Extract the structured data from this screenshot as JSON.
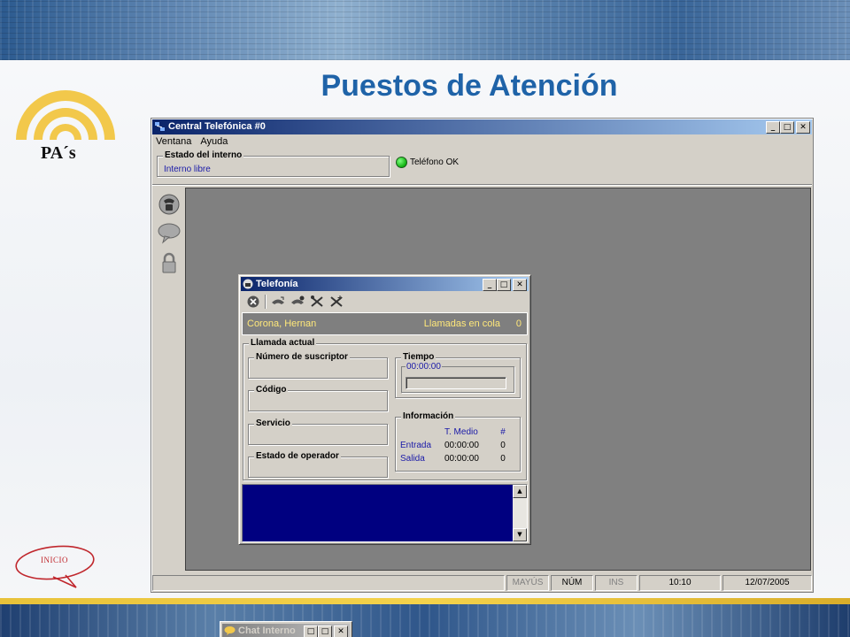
{
  "slide": {
    "title": "Puestos de Atención",
    "logo_text": "PA´s",
    "inicio_label": "INICIO"
  },
  "main_window": {
    "title": "Central Telefónica #0",
    "controls": {
      "minimize": "_",
      "maximize": "□",
      "close": "✕"
    },
    "menu": [
      "Ventana",
      "Ayuda"
    ],
    "estado_label": "Estado del interno",
    "estado_value": "Interno libre",
    "telefono_status": "Teléfono OK",
    "left_toolbar_icons": [
      "phone-icon",
      "chat-bubble-icon",
      "lock-icon"
    ]
  },
  "telefonia": {
    "title": "Telefonía",
    "toolbar_icons": [
      "cancel-circle-icon",
      "answer-call-icon",
      "transfer-call-icon",
      "tools-icon",
      "tools-add-icon"
    ],
    "operator_name": "Corona, Hernan",
    "queue_label": "Llamadas en cola",
    "queue_count": "0",
    "llamada_actual": {
      "label": "Llamada actual",
      "fields": [
        "Número de suscriptor",
        "Código",
        "Servicio",
        "Estado de operador"
      ]
    },
    "tiempo": {
      "label": "Tiempo",
      "value": "00:00:00"
    },
    "informacion": {
      "label": "Información",
      "headers": [
        "T. Medio",
        "#"
      ],
      "rows": [
        {
          "label": "Entrada",
          "t_medio": "00:00:00",
          "count": "0"
        },
        {
          "label": "Salida",
          "t_medio": "00:00:00",
          "count": "0"
        }
      ]
    }
  },
  "chat_window": {
    "title": "Chat Interno"
  },
  "status_bar": {
    "mayus": "MAYÚS",
    "num": "NÚM",
    "ins": "INS",
    "time": "10:10",
    "date": "12/07/2005"
  },
  "colors": {
    "title_blue": "#1f63a8",
    "titlebar_dark": "#0a246a",
    "dialog_face": "#d4d0c8",
    "mdi_gray": "#808080",
    "log_bg": "#000080",
    "info_text_yellow": "#ffe87a",
    "status_green": "#10b010"
  }
}
